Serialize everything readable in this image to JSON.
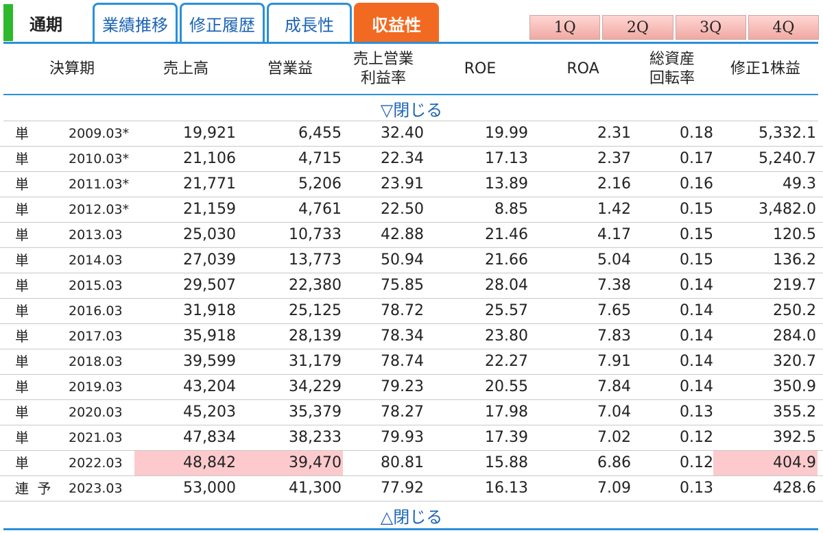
{
  "tabs": {
    "current": "通期",
    "items": [
      {
        "label": "業績推移",
        "active": false
      },
      {
        "label": "修正履歴",
        "active": false
      },
      {
        "label": "成長性",
        "active": false
      },
      {
        "label": "収益性",
        "active": true
      }
    ]
  },
  "quarters": [
    "1Q",
    "2Q",
    "3Q",
    "4Q"
  ],
  "colors": {
    "accent": "#2a8fd8",
    "active_tab": "#f26a21",
    "current_marker": "#2eb82e",
    "highlight": "#fccacd",
    "link": "#1a63b5"
  },
  "table": {
    "headers": {
      "period": "決算期",
      "sales": "売上高",
      "op_income": "営業益",
      "op_margin_1": "売上営業",
      "op_margin_2": "利益率",
      "roe": "ROE",
      "roa": "ROA",
      "turnover_1": "総資産",
      "turnover_2": "回転率",
      "eps": "修正1株益"
    },
    "toggle_top": "▽閉じる",
    "toggle_bottom": "△閉じる",
    "rows": [
      {
        "type": "単",
        "period": "2009.03*",
        "sales": "19,921",
        "op_income": "6,455",
        "op_margin": "32.40",
        "roe": "19.99",
        "roa": "2.31",
        "turnover": "0.18",
        "eps": "5,332.1",
        "highlight": []
      },
      {
        "type": "単",
        "period": "2010.03*",
        "sales": "21,106",
        "op_income": "4,715",
        "op_margin": "22.34",
        "roe": "17.13",
        "roa": "2.37",
        "turnover": "0.17",
        "eps": "5,240.7",
        "highlight": []
      },
      {
        "type": "単",
        "period": "2011.03*",
        "sales": "21,771",
        "op_income": "5,206",
        "op_margin": "23.91",
        "roe": "13.89",
        "roa": "2.16",
        "turnover": "0.16",
        "eps": "49.3",
        "highlight": []
      },
      {
        "type": "単",
        "period": "2012.03*",
        "sales": "21,159",
        "op_income": "4,761",
        "op_margin": "22.50",
        "roe": "8.85",
        "roa": "1.42",
        "turnover": "0.15",
        "eps": "3,482.0",
        "highlight": []
      },
      {
        "type": "単",
        "period": "2013.03",
        "sales": "25,030",
        "op_income": "10,733",
        "op_margin": "42.88",
        "roe": "21.46",
        "roa": "4.17",
        "turnover": "0.15",
        "eps": "120.5",
        "highlight": []
      },
      {
        "type": "単",
        "period": "2014.03",
        "sales": "27,039",
        "op_income": "13,773",
        "op_margin": "50.94",
        "roe": "21.66",
        "roa": "5.04",
        "turnover": "0.15",
        "eps": "136.2",
        "highlight": []
      },
      {
        "type": "単",
        "period": "2015.03",
        "sales": "29,507",
        "op_income": "22,380",
        "op_margin": "75.85",
        "roe": "28.04",
        "roa": "7.38",
        "turnover": "0.14",
        "eps": "219.7",
        "highlight": []
      },
      {
        "type": "単",
        "period": "2016.03",
        "sales": "31,918",
        "op_income": "25,125",
        "op_margin": "78.72",
        "roe": "25.57",
        "roa": "7.65",
        "turnover": "0.14",
        "eps": "250.2",
        "highlight": []
      },
      {
        "type": "単",
        "period": "2017.03",
        "sales": "35,918",
        "op_income": "28,139",
        "op_margin": "78.34",
        "roe": "23.80",
        "roa": "7.83",
        "turnover": "0.14",
        "eps": "284.0",
        "highlight": []
      },
      {
        "type": "単",
        "period": "2018.03",
        "sales": "39,599",
        "op_income": "31,179",
        "op_margin": "78.74",
        "roe": "22.27",
        "roa": "7.91",
        "turnover": "0.14",
        "eps": "320.7",
        "highlight": []
      },
      {
        "type": "単",
        "period": "2019.03",
        "sales": "43,204",
        "op_income": "34,229",
        "op_margin": "79.23",
        "roe": "20.55",
        "roa": "7.84",
        "turnover": "0.14",
        "eps": "350.9",
        "highlight": []
      },
      {
        "type": "単",
        "period": "2020.03",
        "sales": "45,203",
        "op_income": "35,379",
        "op_margin": "78.27",
        "roe": "17.98",
        "roa": "7.04",
        "turnover": "0.13",
        "eps": "355.2",
        "highlight": []
      },
      {
        "type": "単",
        "period": "2021.03",
        "sales": "47,834",
        "op_income": "38,233",
        "op_margin": "79.93",
        "roe": "17.39",
        "roa": "7.02",
        "turnover": "0.12",
        "eps": "392.5",
        "highlight": []
      },
      {
        "type": "単",
        "period": "2022.03",
        "sales": "48,842",
        "op_income": "39,470",
        "op_margin": "80.81",
        "roe": "15.88",
        "roa": "6.86",
        "turnover": "0.12",
        "eps": "404.9",
        "highlight": [
          "sales",
          "op_income",
          "eps"
        ]
      },
      {
        "type": "連 予",
        "period": "2023.03",
        "sales": "53,000",
        "op_income": "41,300",
        "op_margin": "77.92",
        "roe": "16.13",
        "roa": "7.09",
        "turnover": "0.13",
        "eps": "428.6",
        "highlight": []
      }
    ]
  }
}
